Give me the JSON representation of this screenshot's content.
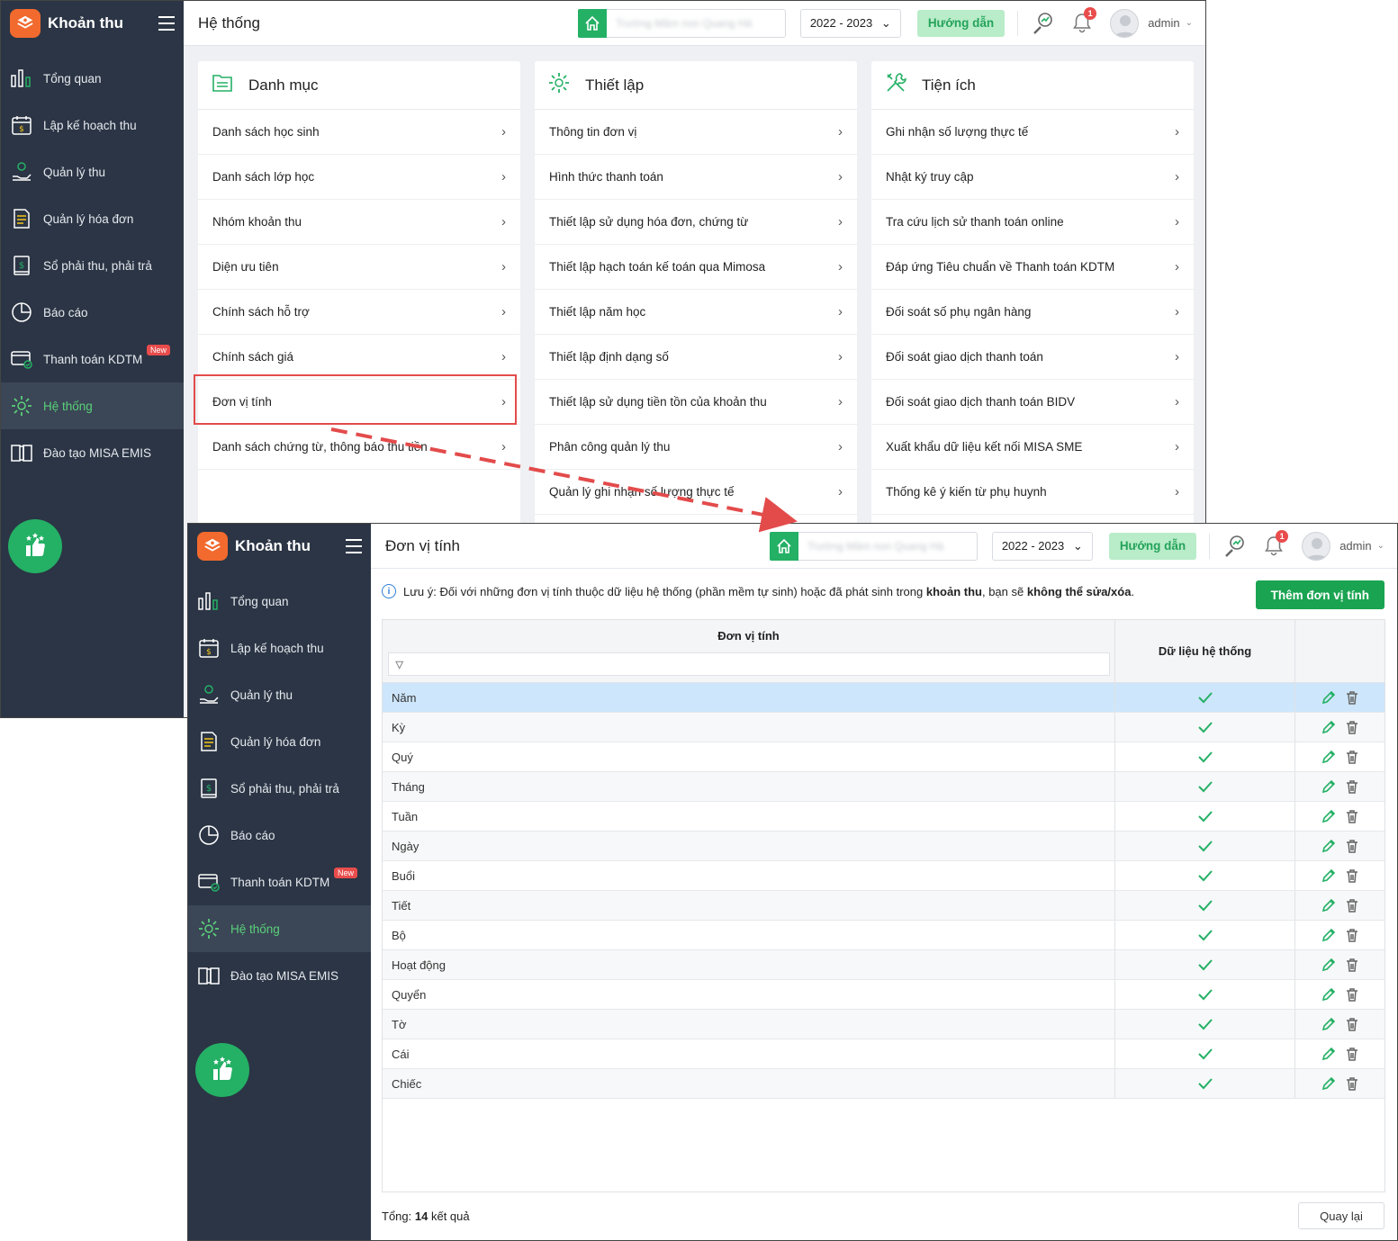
{
  "app": {
    "title": "Khoản thu"
  },
  "sidebar": {
    "items": [
      {
        "label": "Tổng quan",
        "icon": "bar-chart-icon"
      },
      {
        "label": "Lập kế hoạch thu",
        "icon": "calendar-dollar-icon"
      },
      {
        "label": "Quản lý thu",
        "icon": "hand-coin-icon"
      },
      {
        "label": "Quản lý hóa đơn",
        "icon": "invoice-icon"
      },
      {
        "label": "Sổ phải thu, phải trả",
        "icon": "ledger-icon"
      },
      {
        "label": "Báo cáo",
        "icon": "pie-chart-icon"
      },
      {
        "label": "Thanh toán KDTM",
        "icon": "card-check-icon",
        "badge": "New"
      },
      {
        "label": "Hệ thống",
        "icon": "gear-icon",
        "active": true
      },
      {
        "label": "Đào tạo MISA EMIS",
        "icon": "book-icon"
      }
    ]
  },
  "topbar": {
    "school_name": "Trường Mầm non Quang Hà",
    "year": "2022 - 2023",
    "guide_label": "Hướng dẫn",
    "notif_count": "1",
    "user": "admin"
  },
  "screen1": {
    "title": "Hệ thống",
    "columns": [
      {
        "title": "Danh mục",
        "icon": "folder-list-icon",
        "items": [
          "Danh sách học sinh",
          "Danh sách lớp học",
          "Nhóm khoản thu",
          "Diện ưu tiên",
          "Chính sách hỗ trợ",
          "Chính sách giá",
          "Đơn vị tính",
          "Danh sách chứng từ, thông báo thu tiền"
        ]
      },
      {
        "title": "Thiết lập",
        "icon": "gear-icon",
        "items": [
          "Thông tin đơn vị",
          "Hình thức thanh toán",
          "Thiết lập sử dụng hóa đơn, chứng từ",
          "Thiết lập hạch toán kế toán qua Mimosa",
          "Thiết lập năm học",
          "Thiết lập định dạng số",
          "Thiết lập sử dụng tiền tồn của khoản thu",
          "Phân công quản lý thu",
          "Quản lý ghi nhận số lượng thực tế"
        ]
      },
      {
        "title": "Tiện ích",
        "icon": "tools-icon",
        "items": [
          "Ghi nhận số lượng thực tế",
          "Nhật ký truy cập",
          "Tra cứu lịch sử thanh toán online",
          "Đáp ứng Tiêu chuẩn về Thanh toán KDTM",
          "Đối soát số phụ ngân hàng",
          "Đối soát giao dịch thanh toán",
          "Đối soát giao dịch thanh toán BIDV",
          "Xuất khẩu dữ liệu kết nối MISA SME",
          "Thống kê ý kiến từ phụ huynh"
        ]
      }
    ]
  },
  "screen2": {
    "title": "Đơn vị tính",
    "note_prefix": "Lưu ý: Đối với những đơn vị tính thuộc dữ liệu hệ thống (phần mềm tự sinh) hoặc đã phát sinh trong ",
    "note_bold1": "khoản thu",
    "note_mid": ", bạn sẽ ",
    "note_bold2": "không thể sửa/xóa",
    "note_end": ".",
    "add_label": "Thêm đơn vị tính",
    "col_unit": "Đơn vị tính",
    "col_system": "Dữ liệu hệ thống",
    "rows": [
      "Năm",
      "Kỳ",
      "Quý",
      "Tháng",
      "Tuần",
      "Ngày",
      "Buổi",
      "Tiết",
      "Bộ",
      "Hoạt động",
      "Quyển",
      "Tờ",
      "Cái",
      "Chiếc"
    ],
    "total_label": "Tổng:",
    "total_count": "14",
    "total_suffix": "kết quả",
    "back_label": "Quay lại"
  },
  "colors": {
    "sidebar": "#2b3545",
    "accent": "#24b065",
    "highlight": "#e34b4b"
  }
}
